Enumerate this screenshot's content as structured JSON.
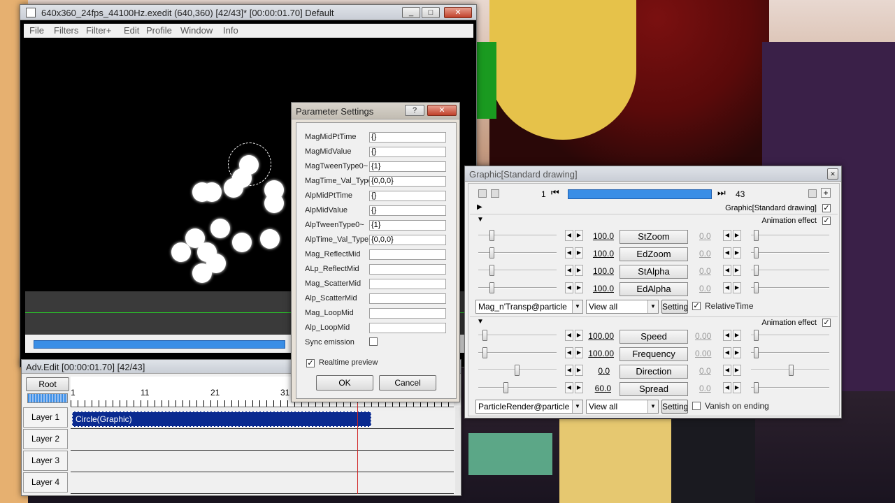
{
  "main": {
    "title": "640x360_24fps_44100Hz.exedit (640,360)  [42/43]* [00:00:01.70]  Default",
    "menu": [
      "File",
      "Filters",
      "Filter+",
      "Edit",
      "Profile",
      "Window",
      "Info"
    ],
    "controls": {
      "min": "_",
      "max": "□",
      "close": "✕"
    }
  },
  "param": {
    "title": "Parameter Settings",
    "help": "?",
    "close": "✕",
    "rows": [
      {
        "label": "MagMidPtTime",
        "value": "{}"
      },
      {
        "label": "MagMidValue",
        "value": "{}"
      },
      {
        "label": "MagTweenType0~",
        "value": "{1}"
      },
      {
        "label": "MagTime_Val_Type",
        "value": "{0,0,0}"
      },
      {
        "label": "AlpMidPtTime",
        "value": "{}"
      },
      {
        "label": "AlpMidValue",
        "value": "{}"
      },
      {
        "label": "AlpTweenType0~",
        "value": "{1}"
      },
      {
        "label": "AlpTime_Val_Type",
        "value": "{0,0,0}"
      },
      {
        "label": "Mag_ReflectMid",
        "value": ""
      },
      {
        "label": "ALp_ReflectMid",
        "value": ""
      },
      {
        "label": "Mag_ScatterMid",
        "value": ""
      },
      {
        "label": "Alp_ScatterMid",
        "value": ""
      },
      {
        "label": "Mag_LoopMid",
        "value": ""
      },
      {
        "label": "Alp_LoopMid",
        "value": ""
      }
    ],
    "sync_label": "Sync emission",
    "preview_label": "Realtime preview",
    "preview_check": "✓",
    "ok": "OK",
    "cancel": "Cancel"
  },
  "graphic": {
    "title": "Graphic[Standard drawing]",
    "close": "✕",
    "frame_start": "1",
    "frame_end": "43",
    "prev_icon": "⏮",
    "next_icon": "⏭",
    "plus": "+",
    "obj_label": "Graphic[Standard drawing]",
    "anim_label": "Animation effect",
    "check": "✓",
    "group1": [
      {
        "name": "StZoom",
        "value": "100.0",
        "end": "0.0"
      },
      {
        "name": "EdZoom",
        "value": "100.0",
        "end": "0.0"
      },
      {
        "name": "StAlpha",
        "value": "100.0",
        "end": "0.0"
      },
      {
        "name": "EdAlpha",
        "value": "100.0",
        "end": "0.0"
      }
    ],
    "combo1": "Mag_n'Transp@particle",
    "view1": "View all",
    "setting": "Setting",
    "relative": "RelativeTime",
    "group2": [
      {
        "name": "Speed",
        "value": "100.00",
        "end": "0.00"
      },
      {
        "name": "Frequency",
        "value": "100.00",
        "end": "0.00"
      },
      {
        "name": "Direction",
        "value": "0.0",
        "end": "0.0"
      },
      {
        "name": "Spread",
        "value": "60.0",
        "end": "0.0"
      }
    ],
    "combo2": "ParticleRender@particle",
    "view2": "View all",
    "vanish": "Vanish on ending"
  },
  "adv": {
    "title": "Adv.Edit [00:00:01.70] [42/43]",
    "root": "Root",
    "ruler": [
      "1",
      "11",
      "21",
      "31"
    ],
    "layers": [
      "Layer 1",
      "Layer 2",
      "Layer 3",
      "Layer 4"
    ],
    "clip": "Circle(Graphic)"
  },
  "colors": {
    "accent": "#3a8ee6",
    "clip": "#0a2a90"
  }
}
